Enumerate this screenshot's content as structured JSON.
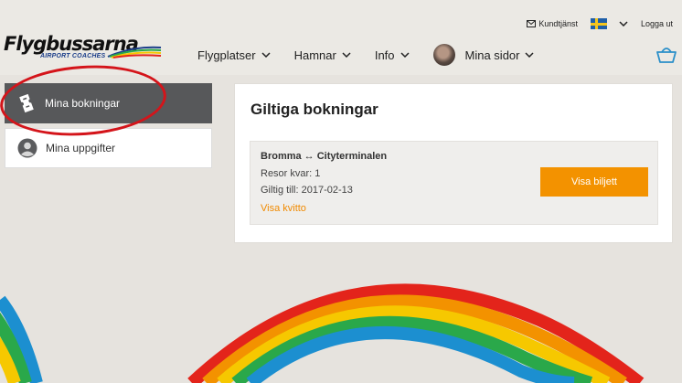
{
  "header": {
    "utility": {
      "support_label": "Kundtjänst",
      "logout_label": "Logga ut",
      "language_flag": "swedish-flag"
    },
    "logo": {
      "name": "Flygbussarna",
      "subtitle": "AIRPORT COACHES"
    },
    "nav": [
      {
        "label": "Flygplatser"
      },
      {
        "label": "Hamnar"
      },
      {
        "label": "Info"
      },
      {
        "label": "Mina sidor"
      }
    ]
  },
  "sidebar": {
    "items": [
      {
        "label": "Mina bokningar",
        "icon": "ticket-icon",
        "active": true
      },
      {
        "label": "Mina uppgifter",
        "icon": "user-icon",
        "active": false
      }
    ]
  },
  "main": {
    "title": "Giltiga bokningar",
    "booking": {
      "route": "Bromma ↔ Cityterminalen",
      "trips_left": "Resor kvar: 1",
      "valid_until": "Giltig till: 2017-02-13",
      "receipt_link": "Visa kvitto",
      "ticket_button": "Visa biljett"
    }
  },
  "colors": {
    "accent": "#f39200",
    "active_sidebar": "#57585a",
    "highlight": "#d4141a"
  }
}
